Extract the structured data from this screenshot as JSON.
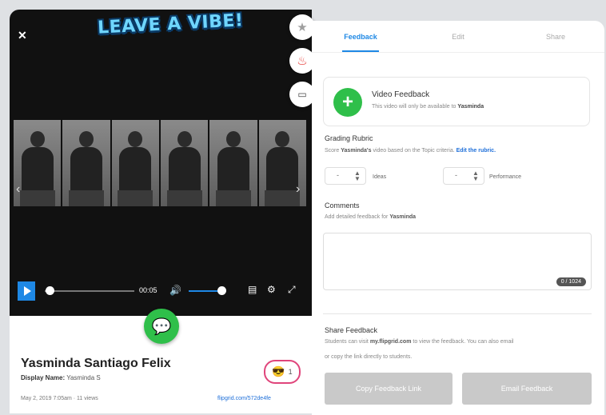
{
  "header": {
    "close_icon": "close-icon",
    "logo_text": "LEAVE A VIBE!"
  },
  "video": {
    "time": "00:05",
    "progress_fraction": 0.05,
    "volume_fraction": 0.9
  },
  "side_actions": [
    {
      "name": "star-icon",
      "glyph": "★",
      "color": "#9e9e9e"
    },
    {
      "name": "fire-icon",
      "glyph": "🔥",
      "color": "#e53935"
    },
    {
      "name": "caption-icon",
      "glyph": "▭",
      "color": "#444"
    }
  ],
  "student": {
    "name": "Yasminda Santiago Felix",
    "display_label": "Display Name:",
    "display_value": "Yasminda S",
    "meta": "May 2, 2019 7:05am · 11 views",
    "link": "flipgrid.com/572de4fe",
    "reaction_count": "1"
  },
  "tabs": [
    {
      "label": "Feedback",
      "active": true
    },
    {
      "label": "Edit",
      "active": false
    },
    {
      "label": "Share",
      "active": false
    }
  ],
  "video_feedback": {
    "title": "Video Feedback",
    "subtitle_prefix": "This video will only be available to",
    "subtitle_name": "Yasminda"
  },
  "grading": {
    "heading": "Grading Rubric",
    "desc_prefix": "Score",
    "desc_name": "Yasminda's",
    "desc_mid": "video based on the Topic criteria.",
    "edit_link": "Edit the rubric.",
    "ideas_value": "-",
    "ideas_label": "Ideas",
    "performance_value": "-",
    "performance_label": "Performance"
  },
  "comments": {
    "heading": "Comments",
    "desc_prefix": "Add detailed feedback for",
    "desc_name": "Yasminda",
    "counter": "0 / 1024"
  },
  "share": {
    "heading": "Share Feedback",
    "line1_prefix": "Students can visit",
    "line1_link": "my.flipgrid.com",
    "line1_suffix": "to view the feedback. You can also email",
    "line2": "or copy the link directly to students.",
    "copy_button": "Copy Feedback Link",
    "email_button": "Email Feedback"
  }
}
